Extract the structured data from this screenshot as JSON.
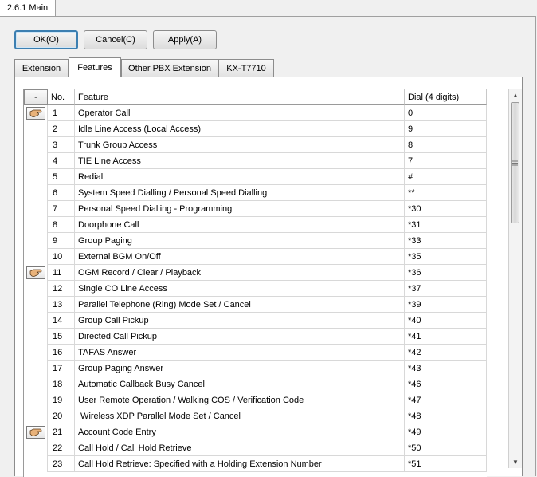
{
  "window": {
    "tab_title": "2.6.1 Main"
  },
  "buttons": {
    "ok": "OK(O)",
    "cancel": "Cancel(C)",
    "apply": "Apply(A)"
  },
  "tabs": [
    "Extension",
    "Features",
    "Other PBX Extension",
    "KX-T7710"
  ],
  "active_tab": "Features",
  "table": {
    "minus_label": "-",
    "columns": [
      "No.",
      "Feature",
      "Dial (4 digits)"
    ],
    "rows": [
      {
        "no": "1",
        "feature": "Operator Call",
        "dial": "0",
        "icon": "hand-icon"
      },
      {
        "no": "2",
        "feature": "Idle Line Access (Local Access)",
        "dial": "9"
      },
      {
        "no": "3",
        "feature": "Trunk Group Access",
        "dial": "8"
      },
      {
        "no": "4",
        "feature": "TIE Line Access",
        "dial": "7"
      },
      {
        "no": "5",
        "feature": "Redial",
        "dial": "#"
      },
      {
        "no": "6",
        "feature": "System Speed Dialling / Personal Speed Dialling",
        "dial": "**"
      },
      {
        "no": "7",
        "feature": "Personal Speed Dialling - Programming",
        "dial": "*30"
      },
      {
        "no": "8",
        "feature": "Doorphone Call",
        "dial": "*31"
      },
      {
        "no": "9",
        "feature": "Group Paging",
        "dial": "*33"
      },
      {
        "no": "10",
        "feature": "External BGM On/Off",
        "dial": "*35"
      },
      {
        "no": "11",
        "feature": "OGM Record / Clear / Playback",
        "dial": "*36",
        "icon": "hand-icon"
      },
      {
        "no": "12",
        "feature": "Single CO Line Access",
        "dial": "*37"
      },
      {
        "no": "13",
        "feature": "Parallel Telephone (Ring) Mode Set / Cancel",
        "dial": "*39"
      },
      {
        "no": "14",
        "feature": "Group Call Pickup",
        "dial": "*40"
      },
      {
        "no": "15",
        "feature": "Directed Call Pickup",
        "dial": "*41"
      },
      {
        "no": "16",
        "feature": "TAFAS Answer",
        "dial": "*42"
      },
      {
        "no": "17",
        "feature": "Group Paging Answer",
        "dial": "*43"
      },
      {
        "no": "18",
        "feature": "Automatic Callback Busy Cancel",
        "dial": "*46"
      },
      {
        "no": "19",
        "feature": "User Remote Operation / Walking COS / Verification Code",
        "dial": "*47"
      },
      {
        "no": "20",
        "feature": " Wireless XDP Parallel Mode Set / Cancel",
        "dial": "*48"
      },
      {
        "no": "21",
        "feature": "Account Code Entry",
        "dial": "*49",
        "icon": "hand-icon"
      },
      {
        "no": "22",
        "feature": "Call Hold / Call Hold Retrieve",
        "dial": "*50"
      },
      {
        "no": "23",
        "feature": "Call Hold Retrieve: Specified with a Holding Extension Number",
        "dial": "*51"
      }
    ]
  }
}
